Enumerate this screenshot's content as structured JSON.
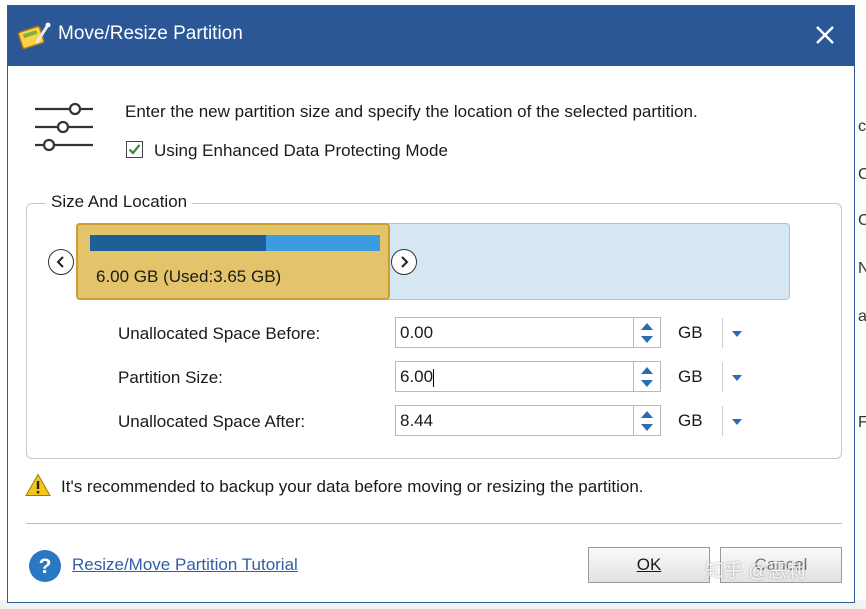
{
  "window": {
    "title": "Move/Resize Partition"
  },
  "intro": {
    "text": "Enter the new partition size and specify the location of the selected partition.",
    "checkbox_label": "Using Enhanced Data Protecting Mode",
    "checkbox_checked": true
  },
  "size_location": {
    "group_label": "Size And Location",
    "partition_label": "6.00 GB (Used:3.65 GB)",
    "used_fraction": 0.608,
    "fields": [
      {
        "label": "Unallocated Space Before:",
        "value": "0.00",
        "unit": "GB"
      },
      {
        "label": "Partition Size:",
        "value": "6.00",
        "unit": "GB"
      },
      {
        "label": "Unallocated Space After:",
        "value": "8.44",
        "unit": "GB"
      }
    ]
  },
  "warning": {
    "text": "It's recommended to backup your data before moving or resizing the partition."
  },
  "footer": {
    "tutorial_link": "Resize/Move Partition Tutorial",
    "ok_label": "OK",
    "cancel_label": "Cancel"
  },
  "background_app": {
    "letters": [
      "c",
      "C",
      "C",
      "N",
      "a",
      "F"
    ]
  },
  "watermark": "知乎 @恶刺",
  "colors": {
    "titlebar": "#2b5797",
    "partition": "#e4c46a",
    "disk_unallocated": "#d4e7f2",
    "used_bar": "#1f5f98",
    "free_bar": "#3e9be0",
    "link": "#2f5fa7"
  }
}
